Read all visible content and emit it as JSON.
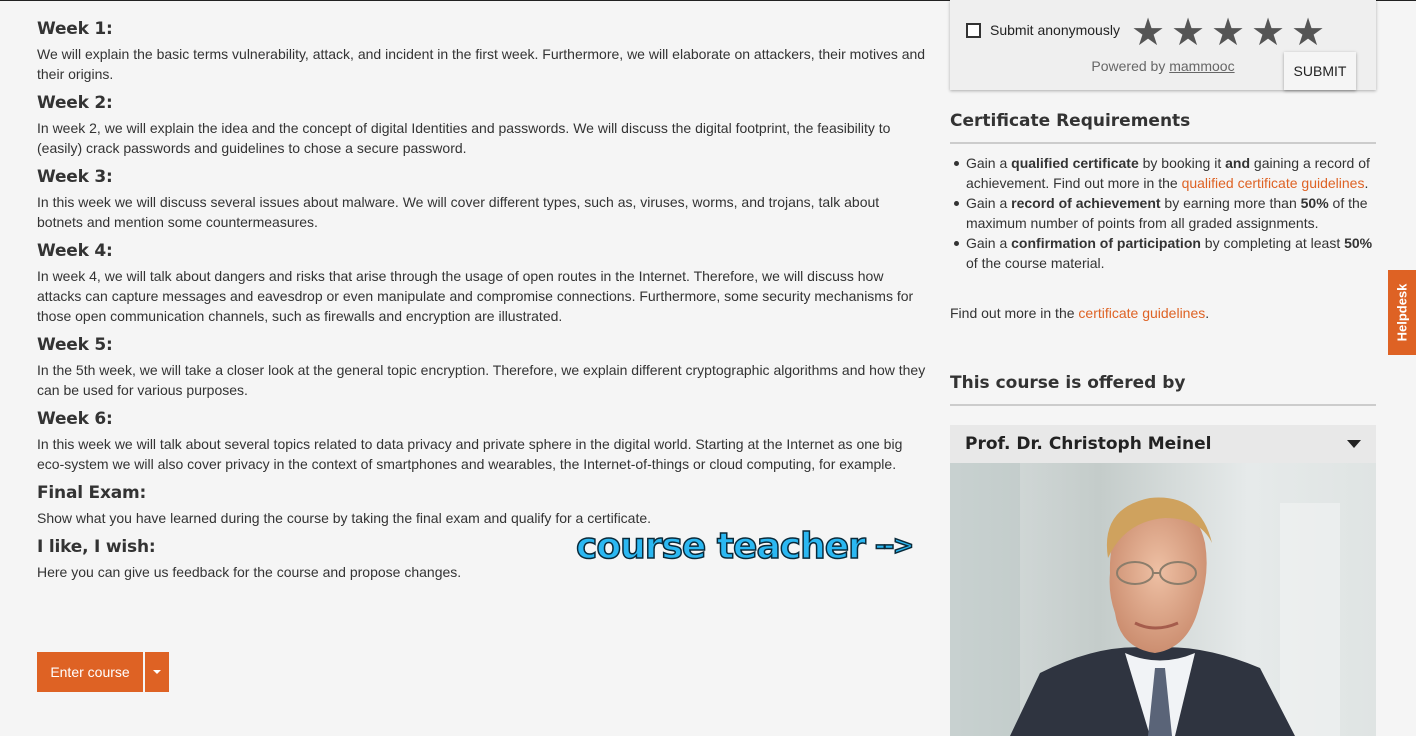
{
  "weeks": [
    {
      "title": "Week 1:",
      "text": "We will explain the basic terms vulnerability, attack, and incident in the first week. Furthermore, we will elaborate on attackers, their motives and their origins."
    },
    {
      "title": "Week 2:",
      "text": "In week 2, we will explain the idea and the concept of digital Identities and passwords. We will discuss the digital footprint, the feasibility to (easily) crack passwords and guidelines to chose a secure password."
    },
    {
      "title": "Week 3:",
      "text": "In this week we will discuss several issues about malware. We will cover different types, such as, viruses, worms, and trojans, talk about botnets and mention some countermeasures."
    },
    {
      "title": "Week 4:",
      "text": "In week 4, we will talk about dangers and risks that arise through the usage of open routes in the Internet. Therefore, we will discuss how attacks can capture messages and eavesdrop or even manipulate and compromise connections. Furthermore, some security mechanisms for those open communication channels, such as firewalls and encryption are illustrated."
    },
    {
      "title": "Week 5:",
      "text": "In the 5th week, we will take a closer look at the general topic encryption. Therefore, we explain different cryptographic algorithms and how they can be used for various purposes."
    },
    {
      "title": "Week 6:",
      "text": "In this week we will talk about several topics related to data privacy and private sphere in the digital world. Starting at the Internet as one big eco-system we will also cover privacy in the context of smartphones and wearables, the Internet-of-things or cloud computing, for example."
    },
    {
      "title": "Final Exam:",
      "text": "Show what you have learned during the course by taking the final exam and qualify for a certificate."
    },
    {
      "title": "I like, I wish:",
      "text": "Here you can give us feedback for the course and propose changes."
    }
  ],
  "enter_button": {
    "label": "Enter course"
  },
  "annotation": {
    "text": "course teacher",
    "arrow": "-->"
  },
  "rating": {
    "anonymous_label": "Submit anonymously",
    "anonymous_checked": false,
    "stars_total": 5,
    "stars_selected": 0,
    "powered_prefix": "Powered by ",
    "powered_link": "mammooc",
    "submit_label": "SUBMIT"
  },
  "certificate": {
    "heading": "Certificate Requirements",
    "items": [
      {
        "p1": "Gain a ",
        "b1": "qualified certificate",
        "p2": " by booking it ",
        "b2": "and",
        "p3": " gaining a record of achievement. Find out more in the ",
        "link": "qualified certificate guidelines",
        "p4": "."
      },
      {
        "p1": "Gain a ",
        "b1": "record of achievement",
        "p2": " by earning more than ",
        "b2": "50%",
        "p3": " of the maximum number of points from all graded assignments."
      },
      {
        "p1": "Gain a ",
        "b1": "confirmation of participation",
        "p2": " by completing at least ",
        "b2": "50%",
        "p3": " of the course material."
      }
    ],
    "more_prefix": "Find out more in the ",
    "more_link": "certificate guidelines",
    "more_suffix": "."
  },
  "offered": {
    "heading": "This course is offered by",
    "teacher_name": "Prof. Dr. Christoph Meinel"
  },
  "helpdesk": {
    "label": "Helpdesk"
  },
  "colors": {
    "accent": "#de6224",
    "annotation": "#2bb8f2"
  }
}
